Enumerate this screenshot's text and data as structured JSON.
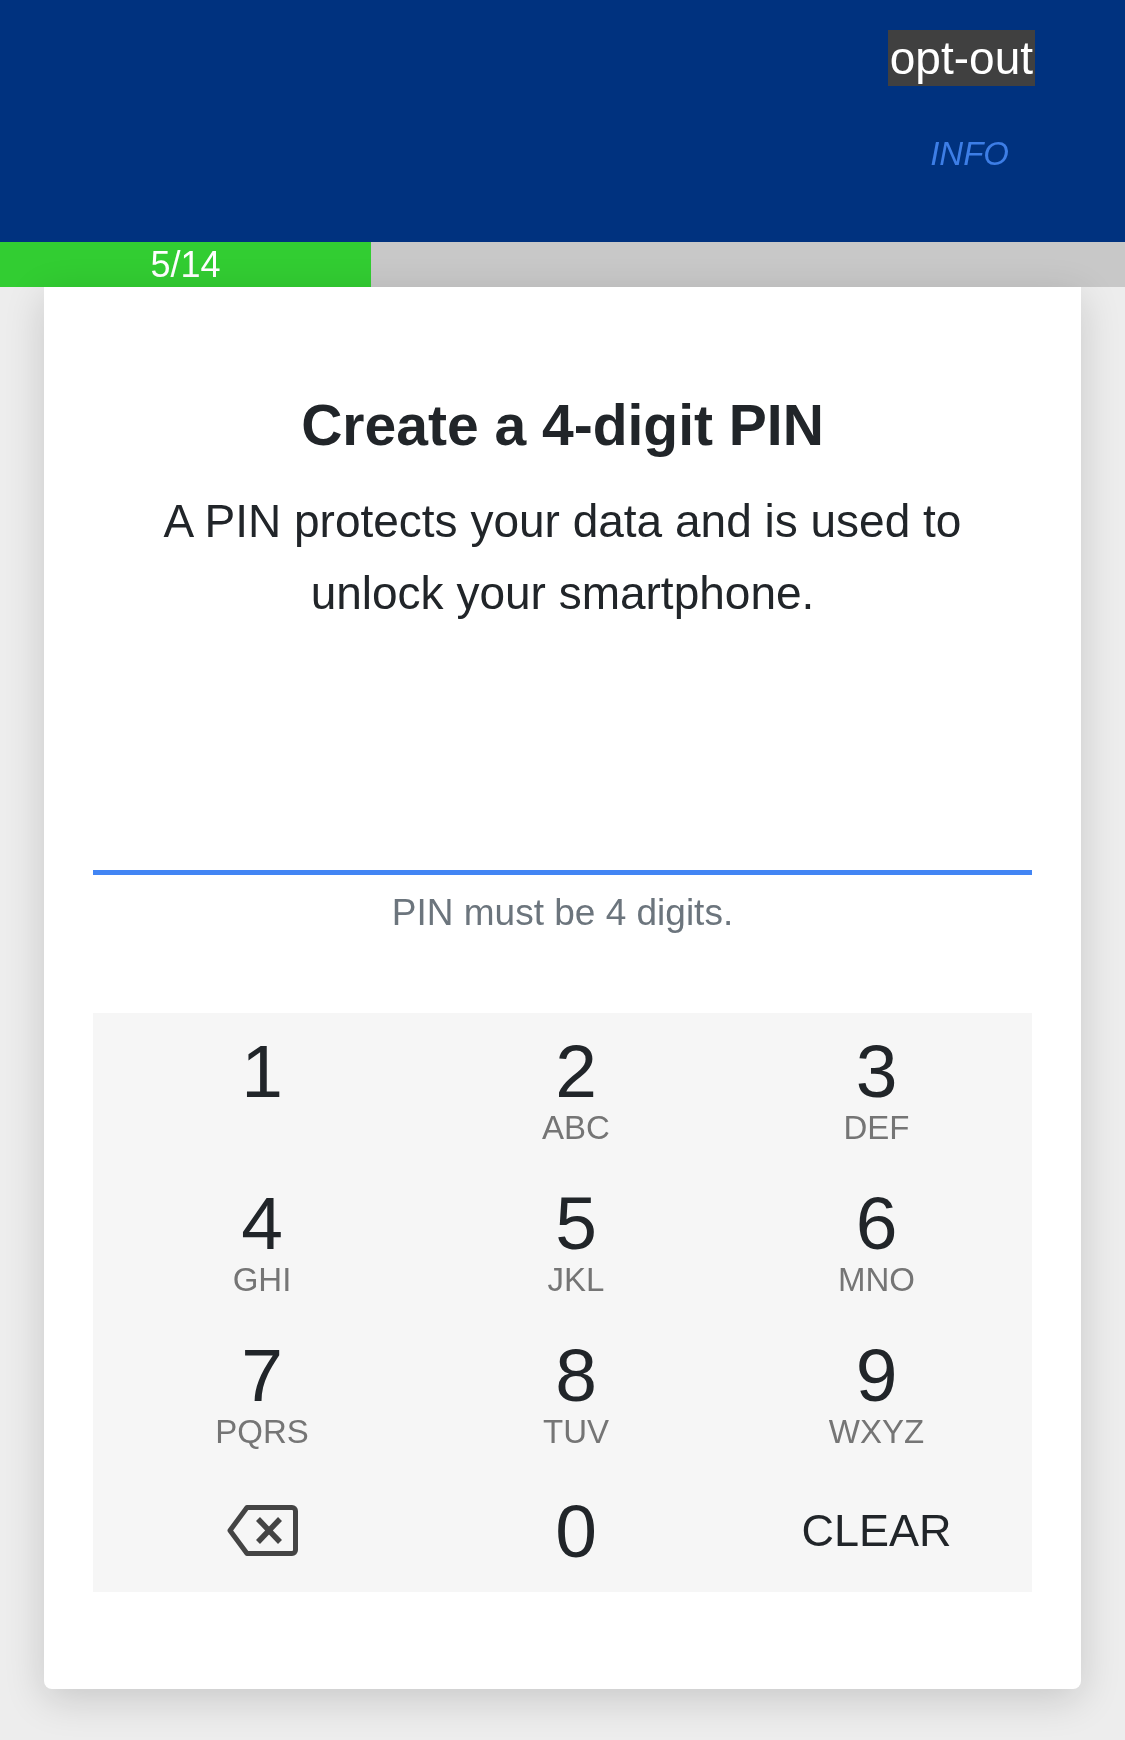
{
  "header": {
    "opt_out": "opt-out",
    "info_link": "INFO"
  },
  "progress": {
    "label": "5/14",
    "level": 0.33
  },
  "card": {
    "title": "Create a 4-digit PIN",
    "description": "A PIN protects your data and is used to unlock your smartphone.",
    "pin_field": {
      "focused": true,
      "helper_text": "PIN must be 4 digits."
    },
    "keypad": [
      {
        "kind": "digit",
        "digit": "1"
      },
      {
        "kind": "digit",
        "digit": "2",
        "letters": "ABC"
      },
      {
        "kind": "digit",
        "digit": "3",
        "letters": "DEF"
      },
      {
        "kind": "digit",
        "digit": "4",
        "letters": "GHI"
      },
      {
        "kind": "digit",
        "digit": "5",
        "letters": "JKL"
      },
      {
        "kind": "digit",
        "digit": "6",
        "letters": "MNO"
      },
      {
        "kind": "digit",
        "digit": "7",
        "letters": "PQRS"
      },
      {
        "kind": "digit",
        "digit": "8",
        "letters": "TUV"
      },
      {
        "kind": "digit",
        "digit": "9",
        "letters": "WXYZ"
      },
      {
        "kind": "backspace"
      },
      {
        "kind": "digit",
        "digit": "0"
      },
      {
        "kind": "text",
        "label": "CLEAR"
      }
    ]
  }
}
